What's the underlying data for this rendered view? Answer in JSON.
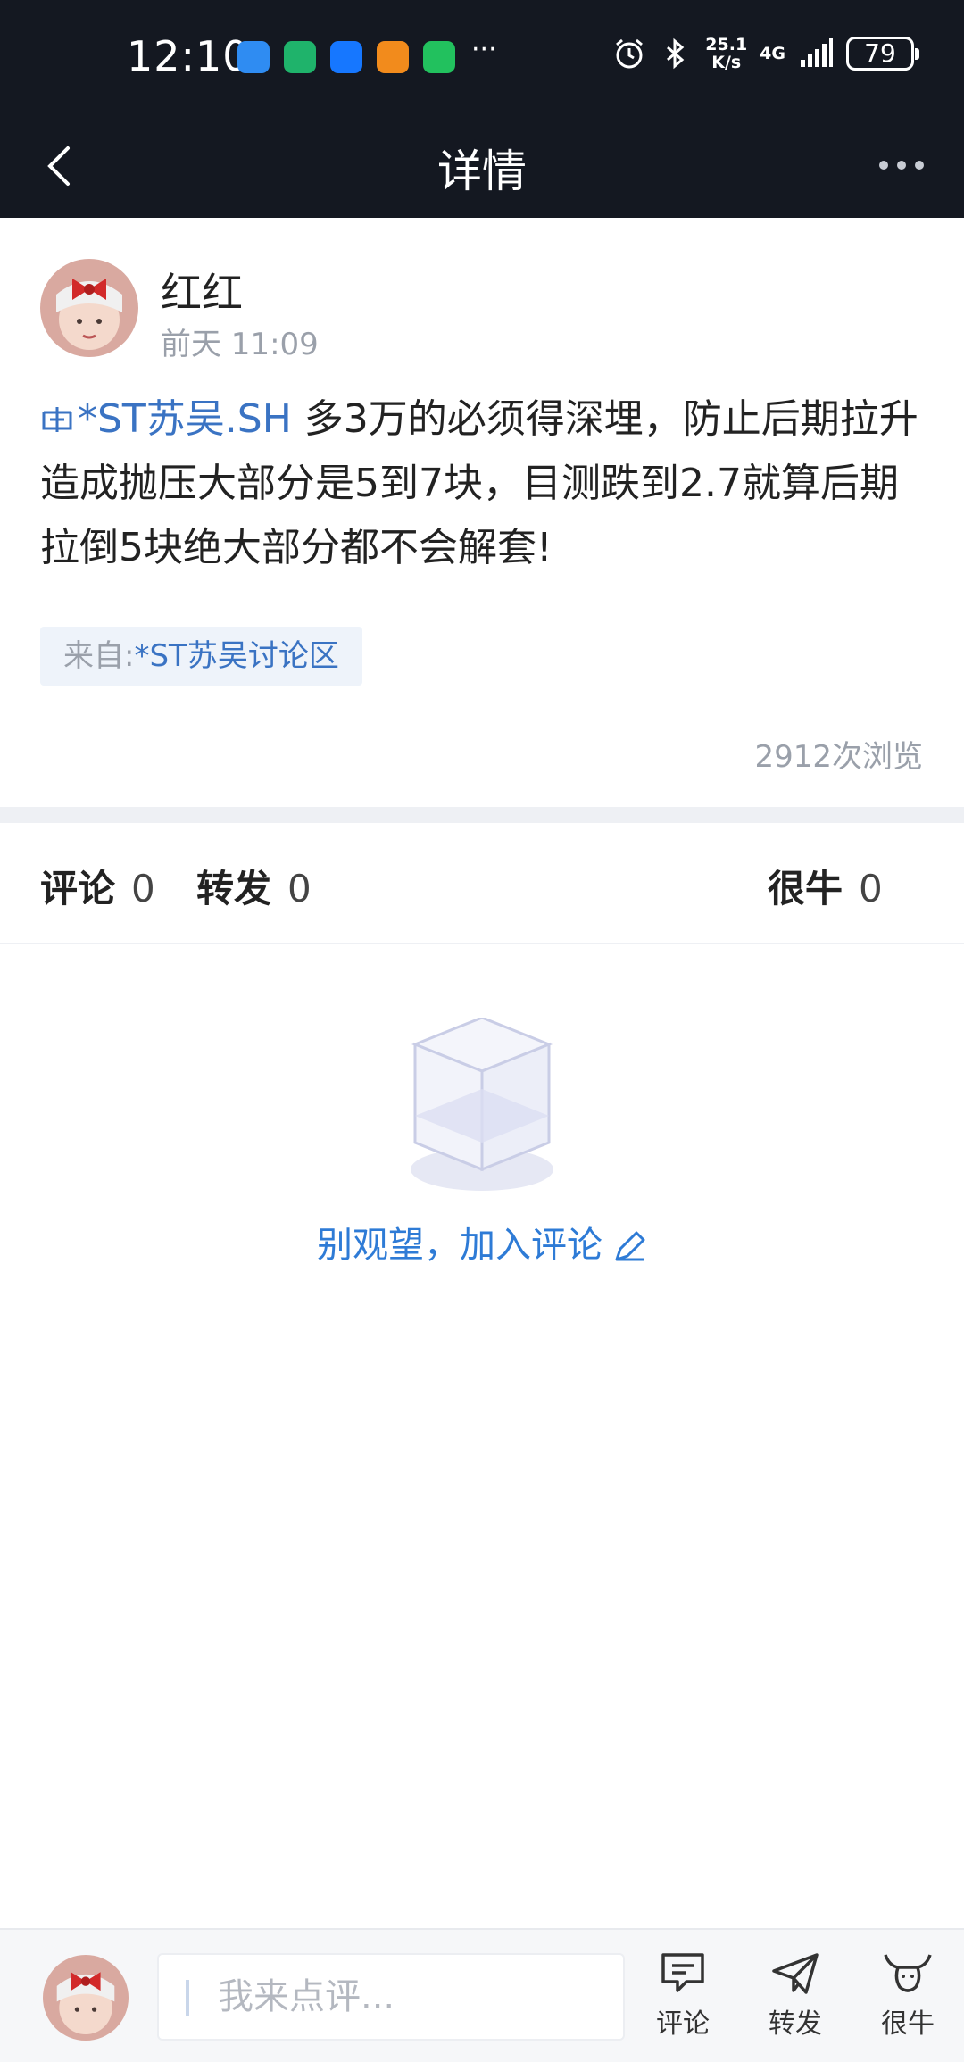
{
  "status_bar": {
    "time": "12:10",
    "net_speed_top": "25.1",
    "net_speed_bottom": "K/s",
    "network": "4G",
    "battery": "79",
    "more": "···"
  },
  "nav": {
    "title": "详情"
  },
  "post": {
    "author": "红红",
    "time": "前天 11:09",
    "stock_link": "*ST苏吴.SH",
    "content": " 多3万的必须得深埋，防止后期拉升造成抛压大部分是5到7块，目测跌到2.7就算后期拉倒5块绝大部分都不会解套!",
    "source_label": "来自:",
    "source_name": "*ST苏吴讨论区",
    "views": "2912次浏览"
  },
  "tabs": {
    "comments_label": "评论",
    "comments_count": "0",
    "reposts_label": "转发",
    "reposts_count": "0",
    "likes_label": "很牛",
    "likes_count": "0"
  },
  "empty_state": {
    "cta": "别观望，加入评论"
  },
  "bottom_bar": {
    "placeholder": "我来点评...",
    "comment_label": "评论",
    "repost_label": "转发",
    "like_label": "很牛"
  },
  "colors": {
    "header_bg": "#141821",
    "link_blue": "#3a73c3",
    "cta_blue": "#2e7bd6"
  }
}
